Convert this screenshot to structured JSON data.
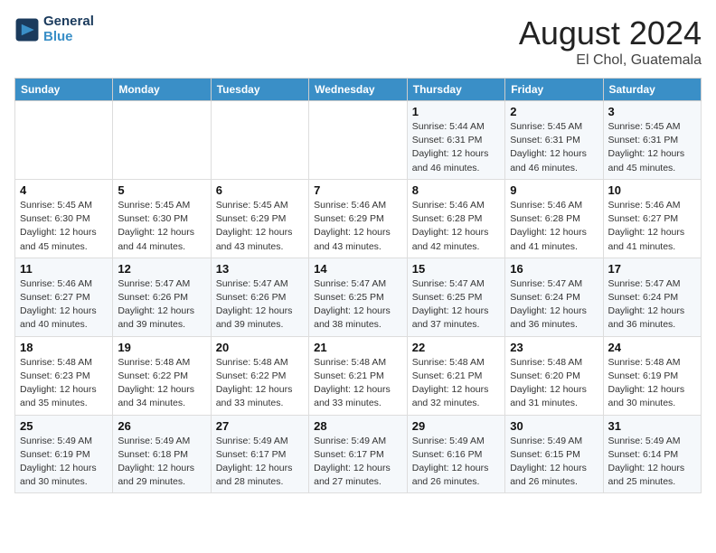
{
  "logo": {
    "line1": "General",
    "line2": "Blue",
    "icon": "▶"
  },
  "title": {
    "month_year": "August 2024",
    "location": "El Chol, Guatemala"
  },
  "weekdays": [
    "Sunday",
    "Monday",
    "Tuesday",
    "Wednesday",
    "Thursday",
    "Friday",
    "Saturday"
  ],
  "weeks": [
    [
      {
        "day": "",
        "info": ""
      },
      {
        "day": "",
        "info": ""
      },
      {
        "day": "",
        "info": ""
      },
      {
        "day": "",
        "info": ""
      },
      {
        "day": "1",
        "info": "Sunrise: 5:44 AM\nSunset: 6:31 PM\nDaylight: 12 hours\nand 46 minutes."
      },
      {
        "day": "2",
        "info": "Sunrise: 5:45 AM\nSunset: 6:31 PM\nDaylight: 12 hours\nand 46 minutes."
      },
      {
        "day": "3",
        "info": "Sunrise: 5:45 AM\nSunset: 6:31 PM\nDaylight: 12 hours\nand 45 minutes."
      }
    ],
    [
      {
        "day": "4",
        "info": "Sunrise: 5:45 AM\nSunset: 6:30 PM\nDaylight: 12 hours\nand 45 minutes."
      },
      {
        "day": "5",
        "info": "Sunrise: 5:45 AM\nSunset: 6:30 PM\nDaylight: 12 hours\nand 44 minutes."
      },
      {
        "day": "6",
        "info": "Sunrise: 5:45 AM\nSunset: 6:29 PM\nDaylight: 12 hours\nand 43 minutes."
      },
      {
        "day": "7",
        "info": "Sunrise: 5:46 AM\nSunset: 6:29 PM\nDaylight: 12 hours\nand 43 minutes."
      },
      {
        "day": "8",
        "info": "Sunrise: 5:46 AM\nSunset: 6:28 PM\nDaylight: 12 hours\nand 42 minutes."
      },
      {
        "day": "9",
        "info": "Sunrise: 5:46 AM\nSunset: 6:28 PM\nDaylight: 12 hours\nand 41 minutes."
      },
      {
        "day": "10",
        "info": "Sunrise: 5:46 AM\nSunset: 6:27 PM\nDaylight: 12 hours\nand 41 minutes."
      }
    ],
    [
      {
        "day": "11",
        "info": "Sunrise: 5:46 AM\nSunset: 6:27 PM\nDaylight: 12 hours\nand 40 minutes."
      },
      {
        "day": "12",
        "info": "Sunrise: 5:47 AM\nSunset: 6:26 PM\nDaylight: 12 hours\nand 39 minutes."
      },
      {
        "day": "13",
        "info": "Sunrise: 5:47 AM\nSunset: 6:26 PM\nDaylight: 12 hours\nand 39 minutes."
      },
      {
        "day": "14",
        "info": "Sunrise: 5:47 AM\nSunset: 6:25 PM\nDaylight: 12 hours\nand 38 minutes."
      },
      {
        "day": "15",
        "info": "Sunrise: 5:47 AM\nSunset: 6:25 PM\nDaylight: 12 hours\nand 37 minutes."
      },
      {
        "day": "16",
        "info": "Sunrise: 5:47 AM\nSunset: 6:24 PM\nDaylight: 12 hours\nand 36 minutes."
      },
      {
        "day": "17",
        "info": "Sunrise: 5:47 AM\nSunset: 6:24 PM\nDaylight: 12 hours\nand 36 minutes."
      }
    ],
    [
      {
        "day": "18",
        "info": "Sunrise: 5:48 AM\nSunset: 6:23 PM\nDaylight: 12 hours\nand 35 minutes."
      },
      {
        "day": "19",
        "info": "Sunrise: 5:48 AM\nSunset: 6:22 PM\nDaylight: 12 hours\nand 34 minutes."
      },
      {
        "day": "20",
        "info": "Sunrise: 5:48 AM\nSunset: 6:22 PM\nDaylight: 12 hours\nand 33 minutes."
      },
      {
        "day": "21",
        "info": "Sunrise: 5:48 AM\nSunset: 6:21 PM\nDaylight: 12 hours\nand 33 minutes."
      },
      {
        "day": "22",
        "info": "Sunrise: 5:48 AM\nSunset: 6:21 PM\nDaylight: 12 hours\nand 32 minutes."
      },
      {
        "day": "23",
        "info": "Sunrise: 5:48 AM\nSunset: 6:20 PM\nDaylight: 12 hours\nand 31 minutes."
      },
      {
        "day": "24",
        "info": "Sunrise: 5:48 AM\nSunset: 6:19 PM\nDaylight: 12 hours\nand 30 minutes."
      }
    ],
    [
      {
        "day": "25",
        "info": "Sunrise: 5:49 AM\nSunset: 6:19 PM\nDaylight: 12 hours\nand 30 minutes."
      },
      {
        "day": "26",
        "info": "Sunrise: 5:49 AM\nSunset: 6:18 PM\nDaylight: 12 hours\nand 29 minutes."
      },
      {
        "day": "27",
        "info": "Sunrise: 5:49 AM\nSunset: 6:17 PM\nDaylight: 12 hours\nand 28 minutes."
      },
      {
        "day": "28",
        "info": "Sunrise: 5:49 AM\nSunset: 6:17 PM\nDaylight: 12 hours\nand 27 minutes."
      },
      {
        "day": "29",
        "info": "Sunrise: 5:49 AM\nSunset: 6:16 PM\nDaylight: 12 hours\nand 26 minutes."
      },
      {
        "day": "30",
        "info": "Sunrise: 5:49 AM\nSunset: 6:15 PM\nDaylight: 12 hours\nand 26 minutes."
      },
      {
        "day": "31",
        "info": "Sunrise: 5:49 AM\nSunset: 6:14 PM\nDaylight: 12 hours\nand 25 minutes."
      }
    ]
  ]
}
